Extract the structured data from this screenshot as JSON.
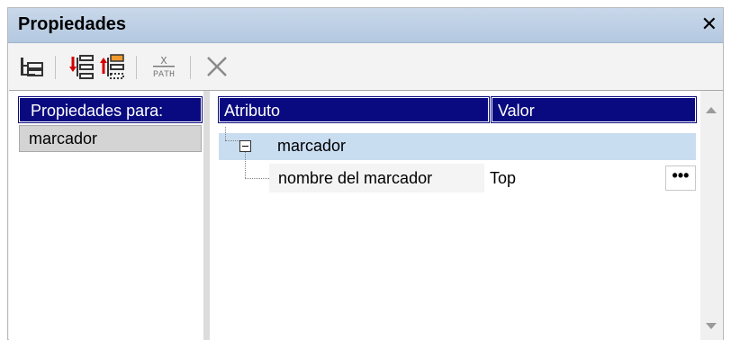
{
  "window": {
    "title": "Propiedades",
    "close_glyph": "✕"
  },
  "toolbar": {
    "buttons": [
      {
        "name": "tree-view-icon"
      },
      {
        "name": "insert-child-icon"
      },
      {
        "name": "append-child-icon"
      },
      {
        "name": "xpath-icon",
        "label_top": "X",
        "label_bottom": "PATH"
      },
      {
        "name": "delete-icon"
      }
    ]
  },
  "left_panel": {
    "header": "Propiedades para:",
    "items": [
      "marcador"
    ]
  },
  "table": {
    "headers": {
      "attribute": "Atributo",
      "value": "Valor"
    },
    "node": {
      "name": "marcador"
    },
    "rows": [
      {
        "attribute": "nombre del marcador",
        "value": "Top",
        "edit_button": "•••"
      }
    ]
  },
  "colors": {
    "header_bg": "#0a0a80",
    "selected_row": "#c9ddf1",
    "titlebar": "#bccfe5"
  }
}
